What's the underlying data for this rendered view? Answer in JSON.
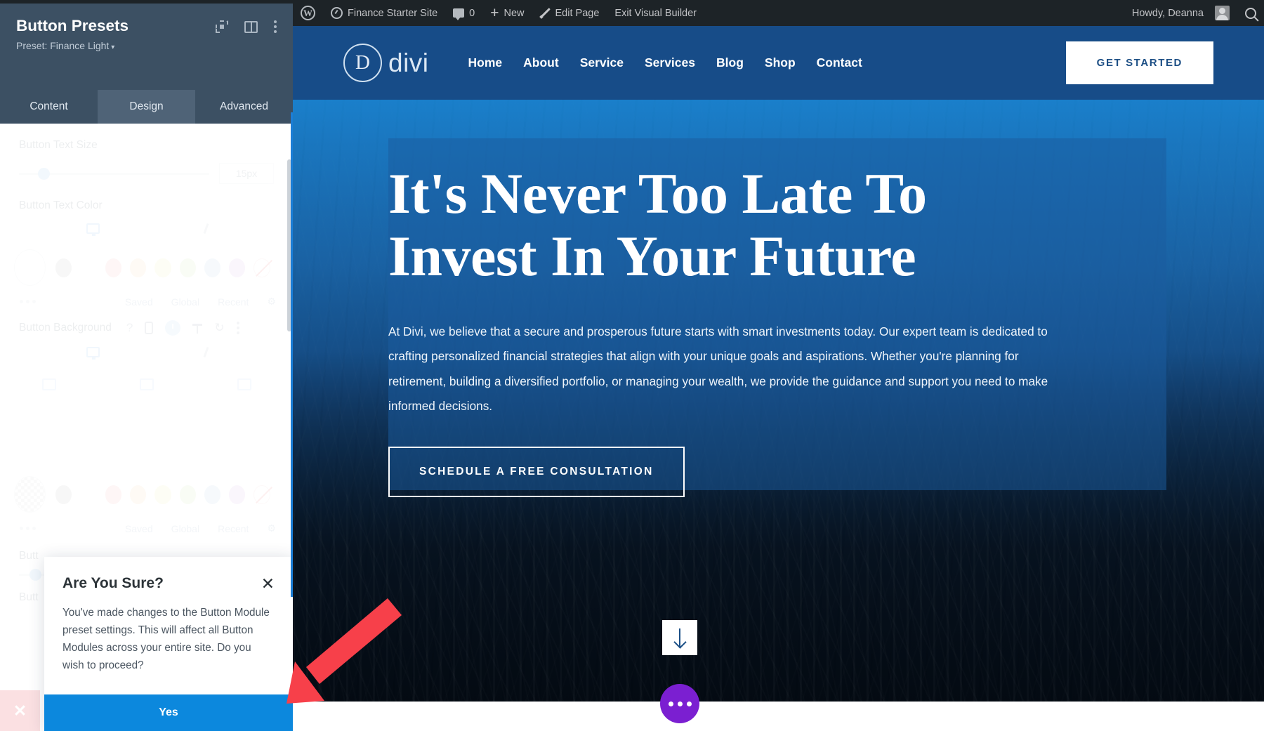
{
  "adminbar": {
    "wp_logo": "wordpress-logo",
    "site_name": "Finance Starter Site",
    "comment_count": "0",
    "new_label": "New",
    "edit_page_label": "Edit Page",
    "exit_builder_label": "Exit Visual Builder",
    "howdy": "Howdy, Deanna",
    "search_icon": "search-icon"
  },
  "site": {
    "nav": {
      "logo_letter": "D",
      "logo_word": "divi",
      "links": [
        "Home",
        "About",
        "Service",
        "Services",
        "Blog",
        "Shop",
        "Contact"
      ],
      "cta_label": "GET STARTED"
    },
    "hero": {
      "heading_line1": "It's Never Too Late To",
      "heading_line2": "Invest In Your Future",
      "paragraph": "At Divi, we believe that a secure and prosperous future starts with smart investments today. Our expert team is dedicated to crafting personalized financial strategies that align with your unique goals and aspirations. Whether you're planning for retirement, building a diversified portfolio, or managing your wealth, we provide the guidance and support you need to make informed decisions.",
      "button_label": "SCHEDULE A FREE CONSULTATION",
      "scroll_icon": "arrow-down-icon",
      "fab_icon": "ellipsis-icon"
    },
    "colors": {
      "nav_bg": "#174c88",
      "panel_overlay": "#1a5ca0",
      "cta_text": "#1d4f85",
      "fab": "#7b1fd1"
    }
  },
  "panel": {
    "title": "Button Presets",
    "preset_label": "Preset: Finance Light",
    "preset_caret": "▾",
    "header_icons": [
      "focus-icon",
      "layout-icon",
      "kebab-menu-icon"
    ],
    "tabs": [
      {
        "label": "Content",
        "active": false
      },
      {
        "label": "Design",
        "active": true
      },
      {
        "label": "Advanced",
        "active": false
      }
    ],
    "fields": {
      "text_size_label": "Button Text Size",
      "text_size_value": "15px",
      "text_color_label": "Button Text Color",
      "background_label": "Button Background",
      "trunc_label_a": "Butt",
      "trunc_label_b": "Butt"
    },
    "swatch_meta": [
      "Saved",
      "Global",
      "Recent"
    ],
    "swatch_colors": [
      "#c3c3c3",
      "#ffffff",
      "#f7bdbd",
      "#f8d9b0",
      "#f6f3b4",
      "#cfe9b6",
      "#bcd5ee",
      "#ddbcee"
    ],
    "icons": {
      "monitor": "monitor-icon",
      "brush": "brush-icon",
      "help": "help-icon",
      "phone": "phone-icon",
      "hover": "hover-state-icon",
      "pin": "pin-icon",
      "reset": "reset-icon",
      "kebab": "kebab-menu-icon",
      "gear": "gear-icon"
    }
  },
  "dialog": {
    "title": "Are You Sure?",
    "close_icon": "close-icon",
    "body": "You've made changes to the Button Module preset settings. This will affect all Button Modules across your entire site. Do you wish to proceed?",
    "confirm_label": "Yes"
  },
  "annotation": {
    "arrow": "red-arrow-pointing-to-yes-button",
    "color": "#f7404a"
  }
}
